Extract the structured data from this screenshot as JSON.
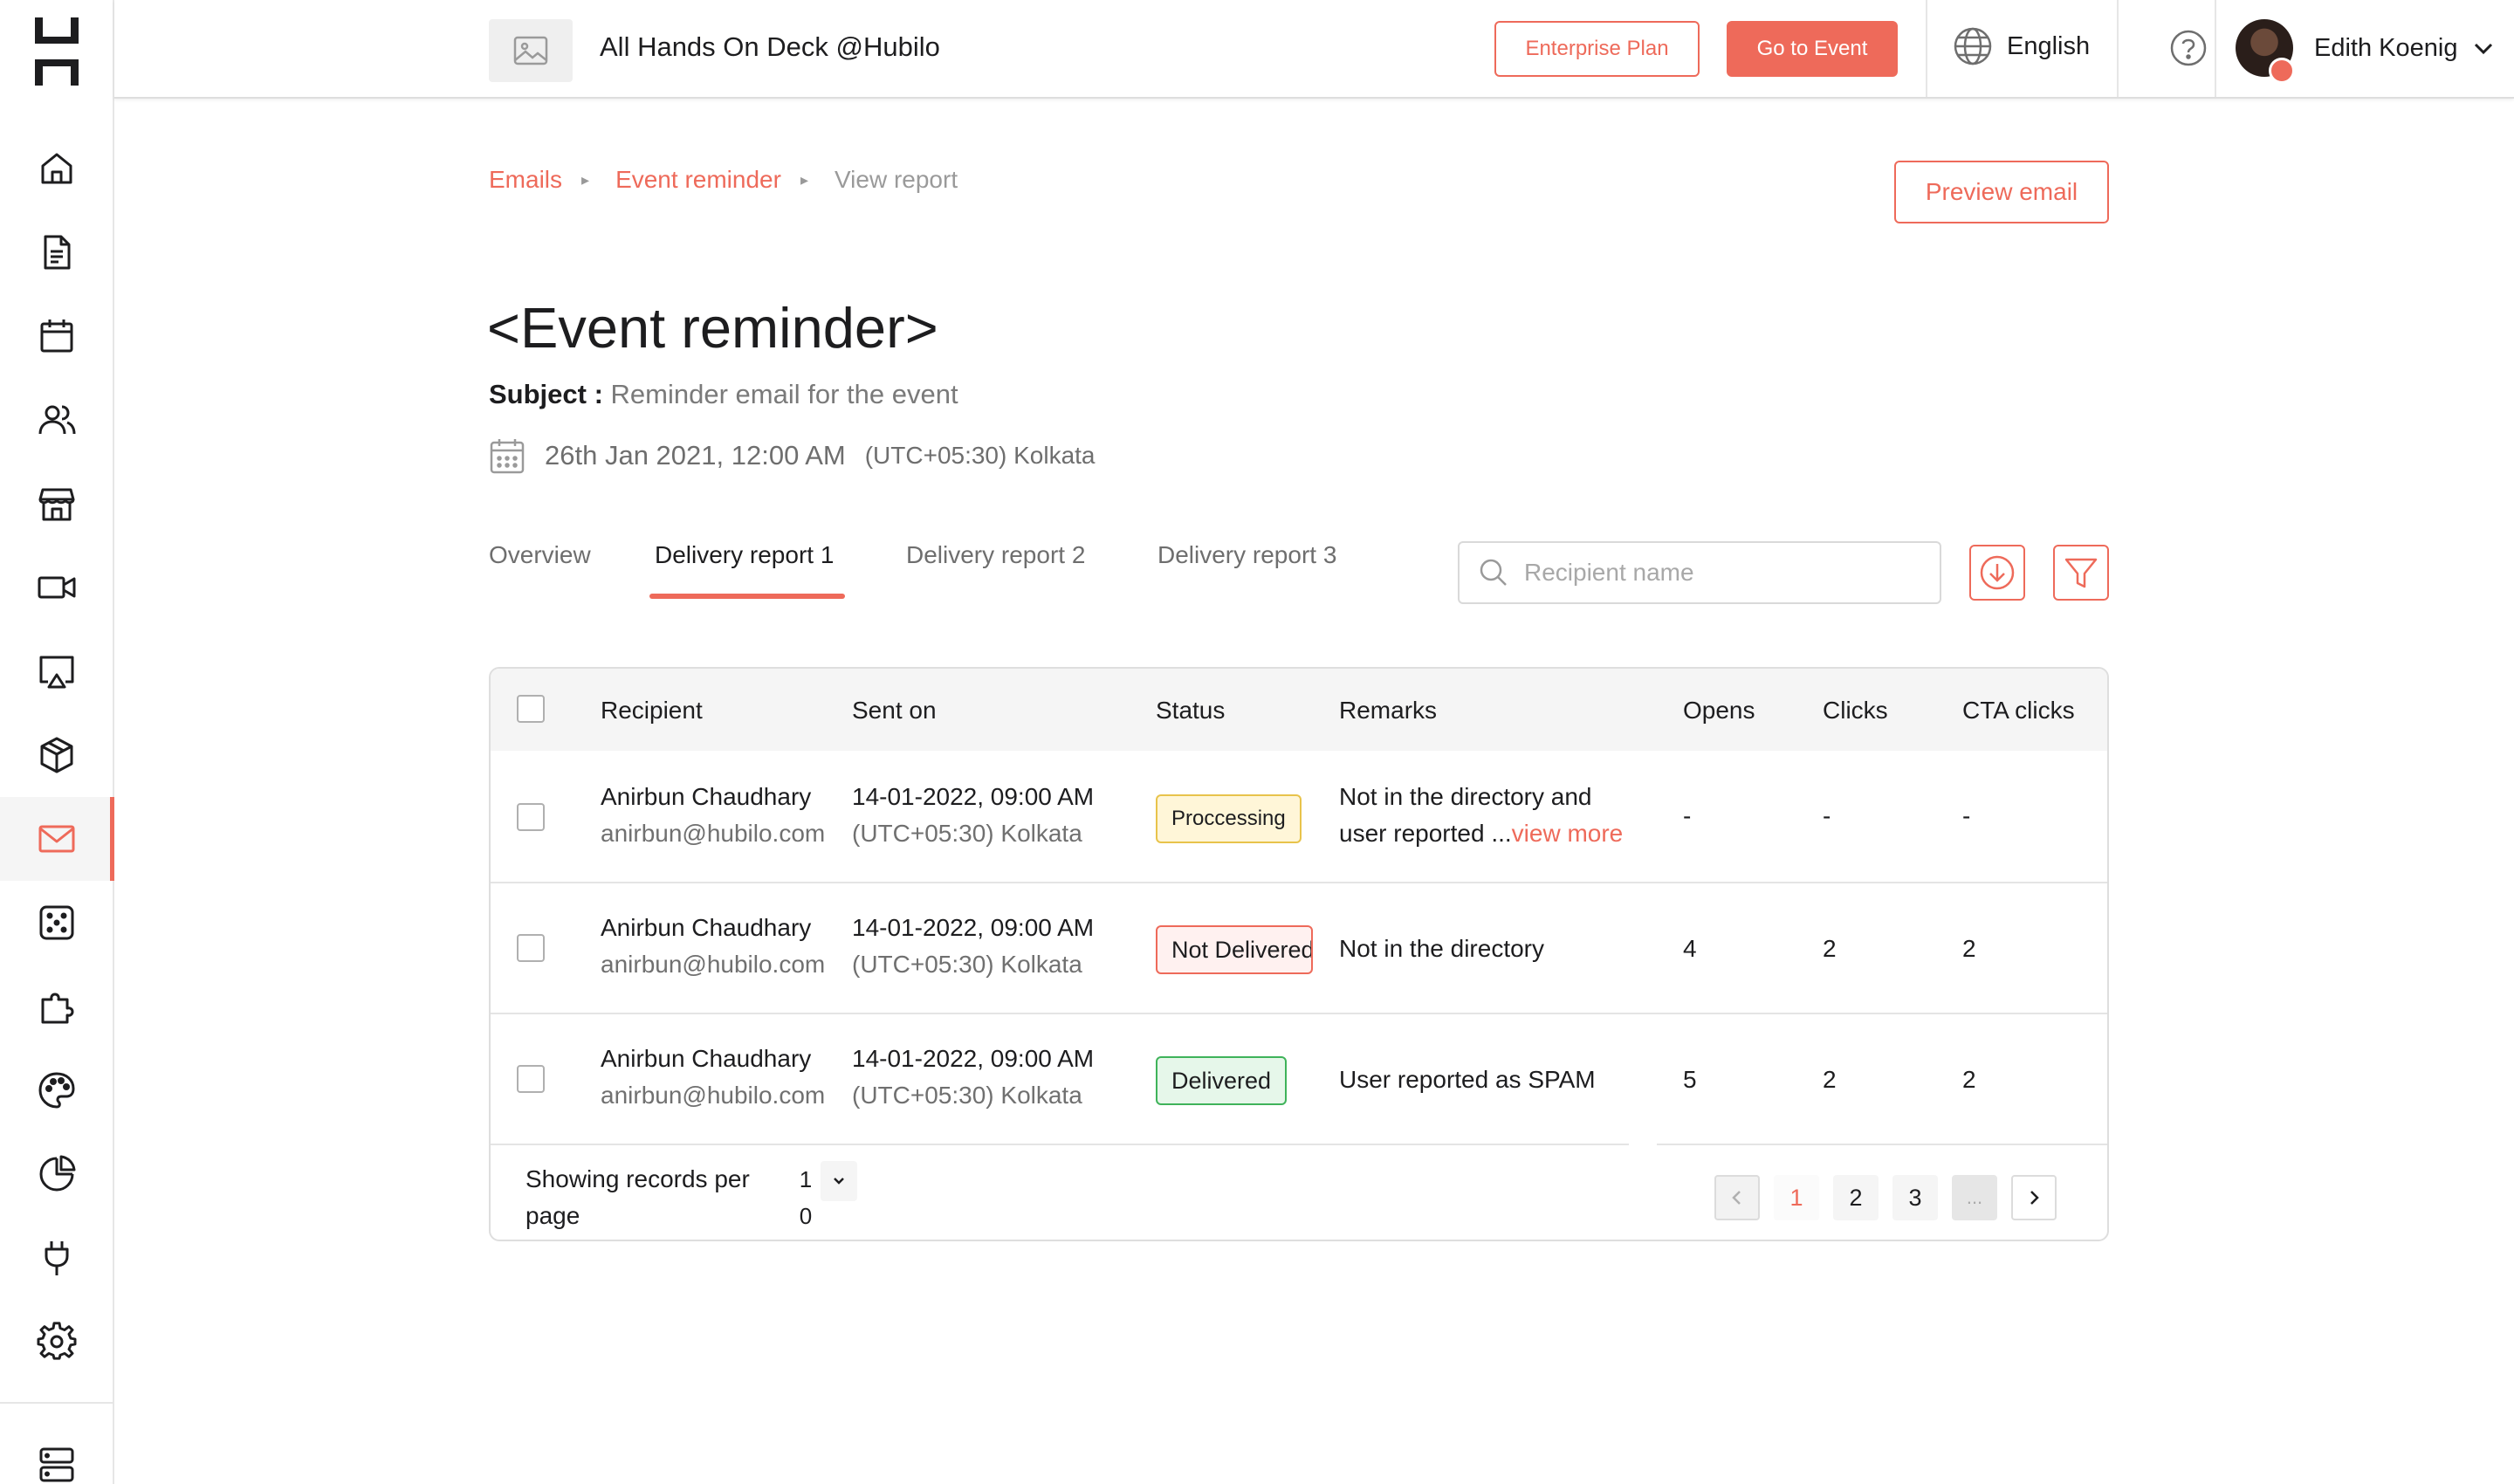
{
  "colors": {
    "accent": "#ee6a5a",
    "processing": "#e8c34b",
    "delivered": "#3fb35a"
  },
  "sidebar": {
    "logo_icon": "hubilo-logo-icon",
    "items": [
      {
        "icon": "home-icon"
      },
      {
        "icon": "document-icon"
      },
      {
        "icon": "calendar-icon"
      },
      {
        "icon": "people-icon"
      },
      {
        "icon": "store-icon"
      },
      {
        "icon": "video-camera-icon"
      },
      {
        "icon": "screen-cast-icon"
      },
      {
        "icon": "box-icon"
      },
      {
        "icon": "mail-icon",
        "active": true
      },
      {
        "icon": "dice-icon"
      },
      {
        "icon": "puzzle-icon"
      },
      {
        "icon": "palette-icon"
      },
      {
        "icon": "pie-chart-icon"
      },
      {
        "icon": "plug-icon"
      },
      {
        "icon": "gear-icon"
      },
      {
        "icon": "server-icon"
      }
    ]
  },
  "header": {
    "event_title": "All Hands On Deck @Hubilo",
    "enterprise_label": "Enterprise Plan",
    "go_to_event_label": "Go to Event",
    "language": "English",
    "user_name": "Edith Koenig"
  },
  "breadcrumb": {
    "items": [
      "Emails",
      "Event reminder"
    ],
    "current": "View report"
  },
  "preview_email_label": "Preview email",
  "page": {
    "title": "<Event reminder>",
    "subject_label": "Subject :",
    "subject_value": "Reminder email for the event",
    "date": "26th Jan 2021, 12:00 AM",
    "timezone": "(UTC+05:30) Kolkata"
  },
  "tabs": [
    {
      "label": "Overview"
    },
    {
      "label": "Delivery report 1",
      "active": true
    },
    {
      "label": "Delivery report 2"
    },
    {
      "label": "Delivery report 3"
    }
  ],
  "search": {
    "placeholder": "Recipient name",
    "value": ""
  },
  "table": {
    "columns": [
      "Recipient",
      "Sent on",
      "Status",
      "Remarks",
      "Opens",
      "Clicks",
      "CTA clicks"
    ],
    "rows": [
      {
        "name": "Anirbun Chaudhary",
        "email": "anirbun@hubilo.com",
        "sent_date": "14-01-2022, 09:00 AM",
        "sent_tz": "(UTC+05:30) Kolkata",
        "status": "Proccessing",
        "remarks_line1": "Not in the directory and",
        "remarks_line2": "user reported ...",
        "view_more": "view more",
        "opens": "-",
        "clicks": "-",
        "cta": "-"
      },
      {
        "name": "Anirbun Chaudhary",
        "email": "anirbun@hubilo.com",
        "sent_date": "14-01-2022, 09:00 AM",
        "sent_tz": "(UTC+05:30) Kolkata",
        "status": "Not Delivered",
        "remarks_line1": "Not in the directory",
        "opens": "4",
        "clicks": "2",
        "cta": "2"
      },
      {
        "name": "Anirbun Chaudhary",
        "email": "anirbun@hubilo.com",
        "sent_date": "14-01-2022, 09:00 AM",
        "sent_tz": "(UTC+05:30) Kolkata",
        "status": "Delivered",
        "remarks_line1": "User reported as SPAM",
        "opens": "5",
        "clicks": "2",
        "cta": "2"
      }
    ]
  },
  "footer": {
    "per_page_label": "Showing records per page",
    "per_page_value": "10",
    "pages": [
      "1",
      "2",
      "3",
      "..."
    ],
    "current_page": "1"
  }
}
